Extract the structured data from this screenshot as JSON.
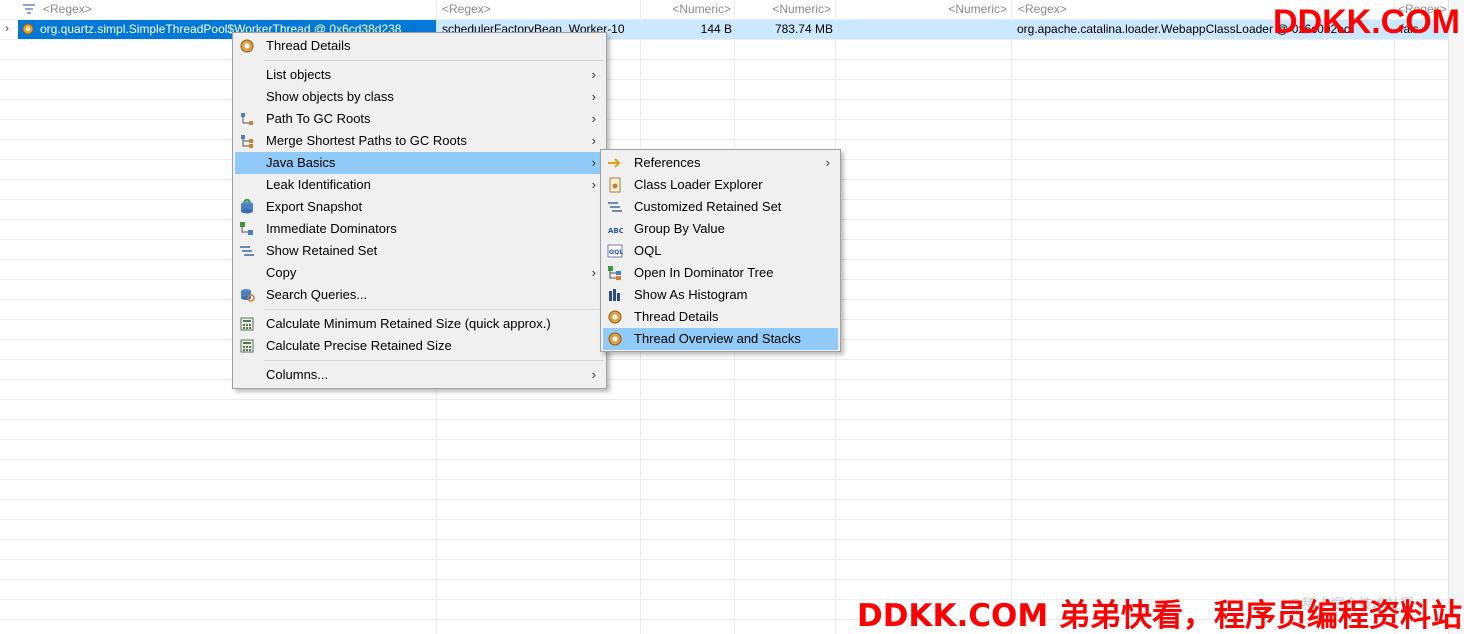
{
  "table": {
    "filters": {
      "col1": "<Regex>",
      "col2": "<Regex>",
      "col3": "<Numeric>",
      "col4": "<Numeric>",
      "col5": "<Numeric>",
      "col6": "<Regex>",
      "col7": "<Regex>"
    },
    "selected_row": {
      "class_name": "org.quartz.simpl.SimpleThreadPool$WorkerThread @ 0x6cd38d238",
      "thread_name": "schedulerFactoryBean_Worker-10",
      "shallow_heap": "144 B",
      "retained_heap": "783.74 MB",
      "context_class_loader": "org.apache.catalina.loader.WebappClassLoader @ 0x6c002ec",
      "is_daemon": "fals"
    }
  },
  "context_menu": {
    "items": [
      {
        "label": "Thread Details",
        "icon": "gear-icon",
        "has_submenu": false
      },
      {
        "label": "List objects",
        "icon": "",
        "has_submenu": true
      },
      {
        "label": "Show objects by class",
        "icon": "",
        "has_submenu": true
      },
      {
        "label": "Path To GC Roots",
        "icon": "tree-path-icon",
        "has_submenu": true
      },
      {
        "label": "Merge Shortest Paths to GC Roots",
        "icon": "merge-path-icon",
        "has_submenu": true
      },
      {
        "label": "Java Basics",
        "icon": "",
        "has_submenu": true,
        "highlighted": true
      },
      {
        "label": "Leak Identification",
        "icon": "",
        "has_submenu": true
      },
      {
        "label": "Export Snapshot",
        "icon": "export-icon",
        "has_submenu": false
      },
      {
        "label": "Immediate Dominators",
        "icon": "dominators-icon",
        "has_submenu": false
      },
      {
        "label": "Show Retained Set",
        "icon": "retained-set-icon",
        "has_submenu": false
      },
      {
        "label": "Copy",
        "icon": "",
        "has_submenu": true
      },
      {
        "label": "Search Queries...",
        "icon": "search-queries-icon",
        "has_submenu": false
      },
      {
        "label": "Calculate Minimum Retained Size (quick approx.)",
        "icon": "calculator-icon",
        "has_submenu": false
      },
      {
        "label": "Calculate Precise Retained Size",
        "icon": "calculator-icon",
        "has_submenu": false
      },
      {
        "label": "Columns...",
        "icon": "",
        "has_submenu": true
      }
    ]
  },
  "submenu": {
    "items": [
      {
        "label": "References",
        "icon": "arrow-right-icon",
        "has_submenu": true
      },
      {
        "label": "Class Loader Explorer",
        "icon": "class-loader-icon",
        "has_submenu": false
      },
      {
        "label": "Customized Retained Set",
        "icon": "retained-set-icon",
        "has_submenu": false
      },
      {
        "label": "Group By Value",
        "icon": "abc-icon",
        "has_submenu": false
      },
      {
        "label": "OQL",
        "icon": "oql-icon",
        "has_submenu": false
      },
      {
        "label": "Open In Dominator Tree",
        "icon": "dominator-tree-icon",
        "has_submenu": false
      },
      {
        "label": "Show As Histogram",
        "icon": "histogram-icon",
        "has_submenu": false
      },
      {
        "label": "Thread Details",
        "icon": "gear-icon",
        "has_submenu": false
      },
      {
        "label": "Thread Overview and Stacks",
        "icon": "gear-icon",
        "has_submenu": false,
        "highlighted": true
      }
    ]
  },
  "watermarks": {
    "top": "DDKK.COM",
    "bottom": "DDKK.COM 弟弟快看，程序员编程资料站",
    "faint": "@稀土掘金技术社区"
  },
  "colors": {
    "selection": "#0078d7",
    "row_highlight": "#cce8ff",
    "menu_highlight": "#91c9f7",
    "watermark": "#ff0000"
  }
}
